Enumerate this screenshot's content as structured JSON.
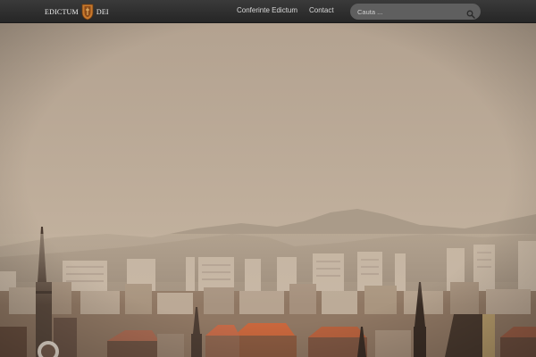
{
  "header": {
    "logo": {
      "left_text": "EDICTUM",
      "right_text": "DEI",
      "crest_icon": "shield-crest-icon"
    },
    "nav": [
      {
        "label": "Conferinte Edictum"
      },
      {
        "label": "Contact"
      }
    ],
    "search": {
      "placeholder": "Cauta ...",
      "icon": "search-icon"
    }
  },
  "hero": {
    "image": "city-skyline-hazy-photo"
  },
  "colors": {
    "navbar": "#2e2e2e",
    "search_field": "#5f5f5f",
    "crest": "#c8782c",
    "sky_top": "#b8a794",
    "haze": "#c8b8a4"
  }
}
